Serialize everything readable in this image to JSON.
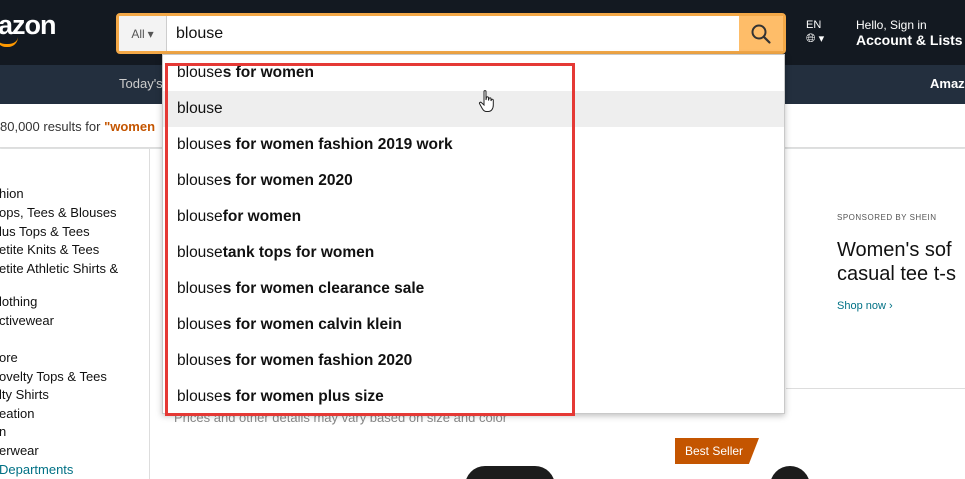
{
  "header": {
    "logo_text": "azon",
    "search": {
      "category": "All",
      "query": "blouse"
    },
    "lang": "EN",
    "account_hello": "Hello, Sign in",
    "account_lists": "Account & Lists"
  },
  "nav": {
    "deals": "Today's",
    "right": "Amaz"
  },
  "results": {
    "prefix": "80,000 results for ",
    "query": "\"women"
  },
  "sidebar": {
    "items": [
      "hion",
      "ops, Tees & Blouses",
      "lus Tops & Tees",
      "etite Knits & Tees",
      "etite Athletic Shirts &",
      "lothing",
      "ctivewear",
      "ore",
      "ovelty Tops & Tees",
      "lty Shirts",
      "eation",
      "n",
      "erwear",
      "Departments"
    ]
  },
  "promo": {
    "sponsored": "SPONSORED BY SHEIN",
    "title_line1": "Women's sof",
    "title_line2": "casual tee t-s",
    "shop_now": "Shop now ›"
  },
  "main": {
    "note": "Prices and other details may vary based on size and color",
    "best_seller": "Best Seller"
  },
  "suggestions": [
    {
      "typed": "blouse",
      "rest": "s for women"
    },
    {
      "typed": "blouse",
      "rest": ""
    },
    {
      "typed": "blouse",
      "rest": "s for women fashion 2019 work"
    },
    {
      "typed": "blouse",
      "rest": "s for women 2020"
    },
    {
      "typed": "blouse",
      "rest": " for women"
    },
    {
      "typed": "blouse",
      "rest": " tank tops for women"
    },
    {
      "typed": "blouse",
      "rest": "s for women clearance sale"
    },
    {
      "typed": "blouse",
      "rest": "s for women calvin klein"
    },
    {
      "typed": "blouse",
      "rest": "s for women fashion 2020"
    },
    {
      "typed": "blouse",
      "rest": "s for women plus size"
    }
  ],
  "colors": {
    "header_bg": "#131921",
    "nav_bg": "#232f3e",
    "search_border": "#f3a847",
    "search_button": "#febd69",
    "highlight_box": "#e53935",
    "link": "#007185"
  }
}
